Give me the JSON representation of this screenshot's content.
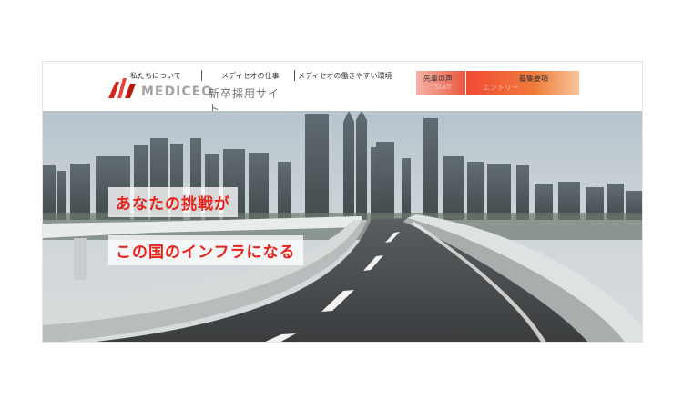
{
  "header": {
    "logo_text": "MEDICEO",
    "logo_subtitle": "新卒採用サイト",
    "nav": [
      {
        "label": "私たちについて"
      },
      {
        "label": "メディセオの仕事"
      },
      {
        "label": "メディセオの働きやすい環境"
      }
    ],
    "cta_voice": "先輩の声",
    "cta_voice_ghost": "Staff",
    "cta_recruit": "募集要項",
    "cta_recruit_ghost": "エントリー",
    "cta_recruit_icon": "circle-arrow-icon"
  },
  "hero": {
    "headline_1": "あなたの挑戦が",
    "headline_2": "この国のインフラになる"
  },
  "colors": {
    "accent_red": "#e8231a",
    "cta_orange": "#f07a3a"
  }
}
